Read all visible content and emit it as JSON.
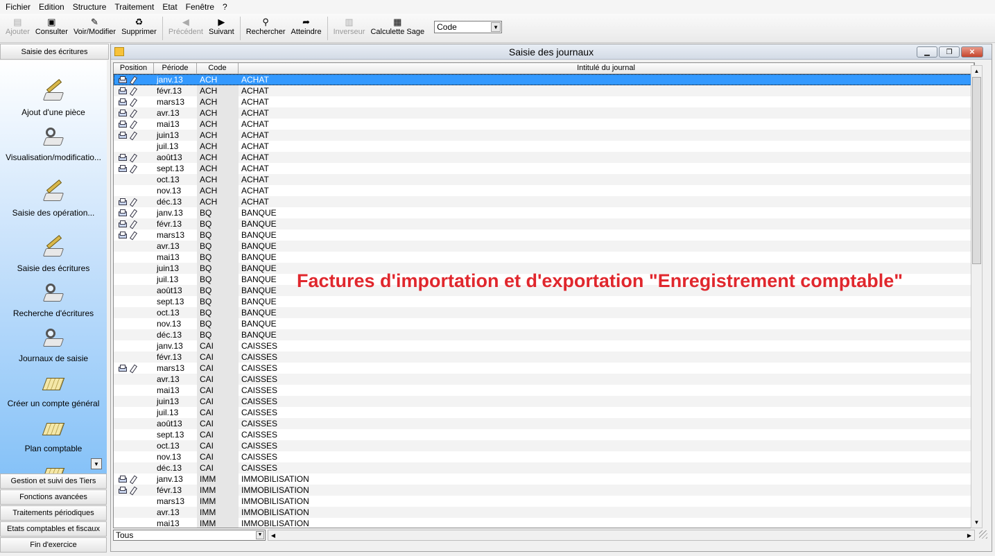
{
  "menubar": {
    "items": [
      "Fichier",
      "Edition",
      "Structure",
      "Traitement",
      "Etat",
      "Fenêtre",
      "?"
    ]
  },
  "toolbar": {
    "buttons": [
      {
        "label": "Ajouter",
        "icon": "add-doc-icon",
        "enabled": false
      },
      {
        "label": "Consulter",
        "icon": "view-doc-icon",
        "enabled": true
      },
      {
        "label": "Voir/Modifier",
        "icon": "edit-doc-icon",
        "enabled": true
      },
      {
        "label": "Supprimer",
        "icon": "trash-icon",
        "enabled": true
      },
      {
        "label": "Précédent",
        "icon": "arrow-left-icon",
        "enabled": false
      },
      {
        "label": "Suivant",
        "icon": "arrow-right-icon",
        "enabled": true
      },
      {
        "label": "Rechercher",
        "icon": "search-icon",
        "enabled": true
      },
      {
        "label": "Atteindre",
        "icon": "goto-icon",
        "enabled": true
      },
      {
        "label": "Inverseur",
        "icon": "inverter-icon",
        "enabled": false
      },
      {
        "label": "Calculette Sage",
        "icon": "calculator-icon",
        "enabled": true
      }
    ],
    "code_select": "Code"
  },
  "left_panel": {
    "header": "Saisie des écritures",
    "items": [
      {
        "label": "Ajout d'une pièce",
        "icon": "pen-pad-icon"
      },
      {
        "label": "Visualisation/modificatio...",
        "icon": "magnifier-pad-icon"
      },
      {
        "label": "Saisie des opération...",
        "icon": "pen-pad-icon"
      },
      {
        "label": "Saisie des écritures",
        "icon": "pen-pad-icon"
      },
      {
        "label": "Recherche d'écritures",
        "icon": "magnifier-pad-icon"
      },
      {
        "label": "Journaux de saisie",
        "icon": "journal-icon"
      },
      {
        "label": "Créer un compte général",
        "icon": "account-grid-icon"
      },
      {
        "label": "Plan comptable",
        "icon": "account-grid-icon"
      }
    ],
    "sections": [
      "Gestion et suivi des Tiers",
      "Fonctions avancées",
      "Traitements périodiques",
      "Etats comptables et fiscaux",
      "Fin d'exercice"
    ]
  },
  "window": {
    "title": "Saisie des journaux",
    "columns": [
      "Position",
      "Période",
      "Code",
      "Intitulé du journal"
    ],
    "rows": [
      {
        "icons": true,
        "periode": "janv.13",
        "code": "ACH",
        "intitule": "ACHAT",
        "selected": true
      },
      {
        "icons": true,
        "periode": "févr.13",
        "code": "ACH",
        "intitule": "ACHAT"
      },
      {
        "icons": true,
        "periode": "mars13",
        "code": "ACH",
        "intitule": "ACHAT"
      },
      {
        "icons": true,
        "periode": "avr.13",
        "code": "ACH",
        "intitule": "ACHAT"
      },
      {
        "icons": true,
        "periode": "mai13",
        "code": "ACH",
        "intitule": "ACHAT"
      },
      {
        "icons": true,
        "periode": "juin13",
        "code": "ACH",
        "intitule": "ACHAT"
      },
      {
        "icons": false,
        "periode": "juil.13",
        "code": "ACH",
        "intitule": "ACHAT"
      },
      {
        "icons": true,
        "periode": "août13",
        "code": "ACH",
        "intitule": "ACHAT"
      },
      {
        "icons": true,
        "periode": "sept.13",
        "code": "ACH",
        "intitule": "ACHAT"
      },
      {
        "icons": false,
        "periode": "oct.13",
        "code": "ACH",
        "intitule": "ACHAT"
      },
      {
        "icons": false,
        "periode": "nov.13",
        "code": "ACH",
        "intitule": "ACHAT"
      },
      {
        "icons": true,
        "periode": "déc.13",
        "code": "ACH",
        "intitule": "ACHAT"
      },
      {
        "icons": true,
        "periode": "janv.13",
        "code": "BQ",
        "intitule": "BANQUE"
      },
      {
        "icons": true,
        "periode": "févr.13",
        "code": "BQ",
        "intitule": "BANQUE"
      },
      {
        "icons": true,
        "periode": "mars13",
        "code": "BQ",
        "intitule": "BANQUE"
      },
      {
        "icons": false,
        "periode": "avr.13",
        "code": "BQ",
        "intitule": "BANQUE"
      },
      {
        "icons": false,
        "periode": "mai13",
        "code": "BQ",
        "intitule": "BANQUE"
      },
      {
        "icons": false,
        "periode": "juin13",
        "code": "BQ",
        "intitule": "BANQUE"
      },
      {
        "icons": false,
        "periode": "juil.13",
        "code": "BQ",
        "intitule": "BANQUE"
      },
      {
        "icons": false,
        "periode": "août13",
        "code": "BQ",
        "intitule": "BANQUE"
      },
      {
        "icons": false,
        "periode": "sept.13",
        "code": "BQ",
        "intitule": "BANQUE"
      },
      {
        "icons": false,
        "periode": "oct.13",
        "code": "BQ",
        "intitule": "BANQUE"
      },
      {
        "icons": false,
        "periode": "nov.13",
        "code": "BQ",
        "intitule": "BANQUE"
      },
      {
        "icons": false,
        "periode": "déc.13",
        "code": "BQ",
        "intitule": "BANQUE"
      },
      {
        "icons": false,
        "periode": "janv.13",
        "code": "CAI",
        "intitule": "CAISSES"
      },
      {
        "icons": false,
        "periode": "févr.13",
        "code": "CAI",
        "intitule": "CAISSES"
      },
      {
        "icons": true,
        "periode": "mars13",
        "code": "CAI",
        "intitule": "CAISSES"
      },
      {
        "icons": false,
        "periode": "avr.13",
        "code": "CAI",
        "intitule": "CAISSES"
      },
      {
        "icons": false,
        "periode": "mai13",
        "code": "CAI",
        "intitule": "CAISSES"
      },
      {
        "icons": false,
        "periode": "juin13",
        "code": "CAI",
        "intitule": "CAISSES"
      },
      {
        "icons": false,
        "periode": "juil.13",
        "code": "CAI",
        "intitule": "CAISSES"
      },
      {
        "icons": false,
        "periode": "août13",
        "code": "CAI",
        "intitule": "CAISSES"
      },
      {
        "icons": false,
        "periode": "sept.13",
        "code": "CAI",
        "intitule": "CAISSES"
      },
      {
        "icons": false,
        "periode": "oct.13",
        "code": "CAI",
        "intitule": "CAISSES"
      },
      {
        "icons": false,
        "periode": "nov.13",
        "code": "CAI",
        "intitule": "CAISSES"
      },
      {
        "icons": false,
        "periode": "déc.13",
        "code": "CAI",
        "intitule": "CAISSES"
      },
      {
        "icons": true,
        "periode": "janv.13",
        "code": "IMM",
        "intitule": "IMMOBILISATION"
      },
      {
        "icons": true,
        "periode": "févr.13",
        "code": "IMM",
        "intitule": "IMMOBILISATION"
      },
      {
        "icons": false,
        "periode": "mars13",
        "code": "IMM",
        "intitule": "IMMOBILISATION"
      },
      {
        "icons": false,
        "periode": "avr.13",
        "code": "IMM",
        "intitule": "IMMOBILISATION"
      },
      {
        "icons": false,
        "periode": "mai13",
        "code": "IMM",
        "intitule": "IMMOBILISATION"
      }
    ],
    "filter_select": "Tous"
  },
  "overlay_text": "Factures d'importation et d'exportation \"Enregistrement comptable\"",
  "colors": {
    "selection": "#3399ff",
    "overlay_text": "#e0272d",
    "panel_gradient_bottom": "#86c2f8"
  }
}
